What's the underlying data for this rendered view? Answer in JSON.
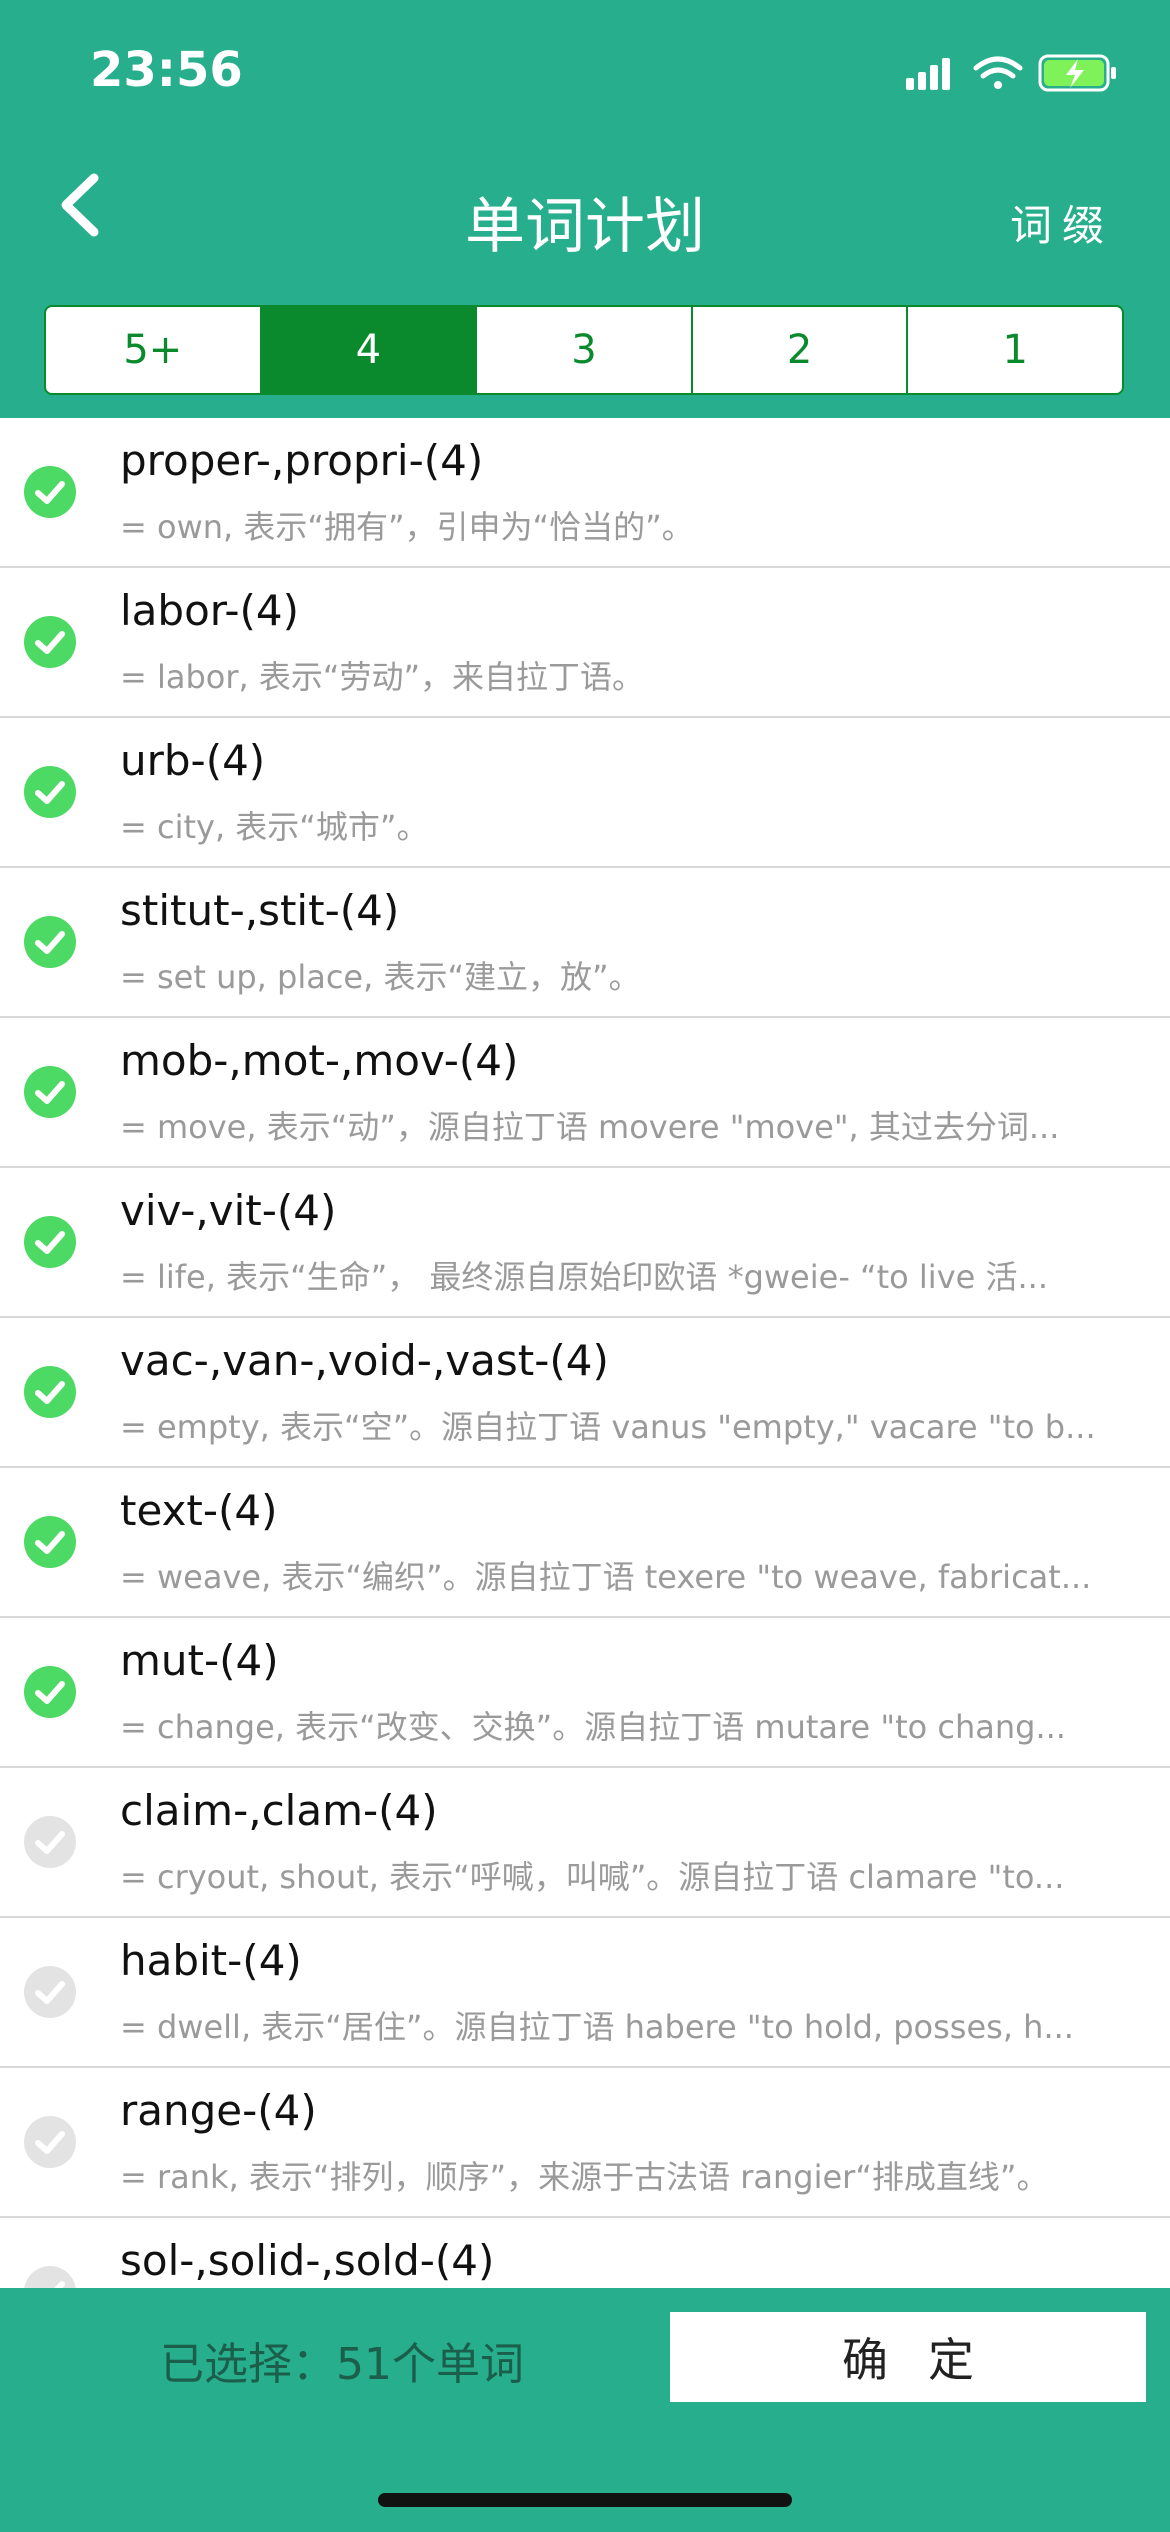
{
  "status_bar": {
    "time": "23:56",
    "icons": [
      "signal-icon",
      "wifi-icon",
      "battery-charging-icon"
    ]
  },
  "nav": {
    "title": "单词计划",
    "right_label": "词缀",
    "back_icon": "chevron-left-icon"
  },
  "tabs": {
    "items": [
      "5+",
      "4",
      "3",
      "2",
      "1"
    ],
    "selected": "4"
  },
  "colors": {
    "brand": "#27ae8c",
    "tab_active": "#0a8a2c",
    "check_on": "#4cd964",
    "check_off": "#e3e3e3"
  },
  "items": [
    {
      "title": "proper-,propri-(4)",
      "desc": "= own, 表示“拥有”，引申为“恰当的”。",
      "checked": true
    },
    {
      "title": "labor-(4)",
      "desc": "= labor, 表示“劳动”，来自拉丁语。",
      "checked": true
    },
    {
      "title": "urb-(4)",
      "desc": "= city, 表示“城市”。",
      "checked": true
    },
    {
      "title": "stitut-,stit-(4)",
      "desc": "= set up, place, 表示“建立，放”。",
      "checked": true
    },
    {
      "title": "mob-,mot-,mov-(4)",
      "desc": "= move, 表示“动”，源自拉丁语 movere \"move\", 其过去分词...",
      "checked": true
    },
    {
      "title": "viv-,vit-(4)",
      "desc": "= life, 表示“生命”，  最终源自原始印欧语 *gweie- “to live 活...",
      "checked": true
    },
    {
      "title": "vac-,van-,void-,vast-(4)",
      "desc": "= empty, 表示“空”。源自拉丁语 vanus \"empty,\" vacare \"to b...",
      "checked": true
    },
    {
      "title": "text-(4)",
      "desc": "= weave, 表示“编织”。源自拉丁语 texere \"to weave, fabricat...",
      "checked": true
    },
    {
      "title": "mut-(4)",
      "desc": "= change, 表示“改变、交换”。源自拉丁语 mutare \"to chang...",
      "checked": true
    },
    {
      "title": "claim-,clam-(4)",
      "desc": "= cryout, shout, 表示“呼喊，叫喊”。源自拉丁语 clamare \"to...",
      "checked": false
    },
    {
      "title": "habit-(4)",
      "desc": "= dwell, 表示“居住”。源自拉丁语 habere \"to hold, posses, h...",
      "checked": false
    },
    {
      "title": "range-(4)",
      "desc": "= rank, 表示“排列，顺序”，来源于古法语 rangier“排成直线”。",
      "checked": false
    },
    {
      "title": "sol-,solid-,sold-(4)",
      "desc": "",
      "checked": false
    }
  ],
  "footer": {
    "selected_text": "已选择：51个单词",
    "confirm_label": "确定"
  }
}
